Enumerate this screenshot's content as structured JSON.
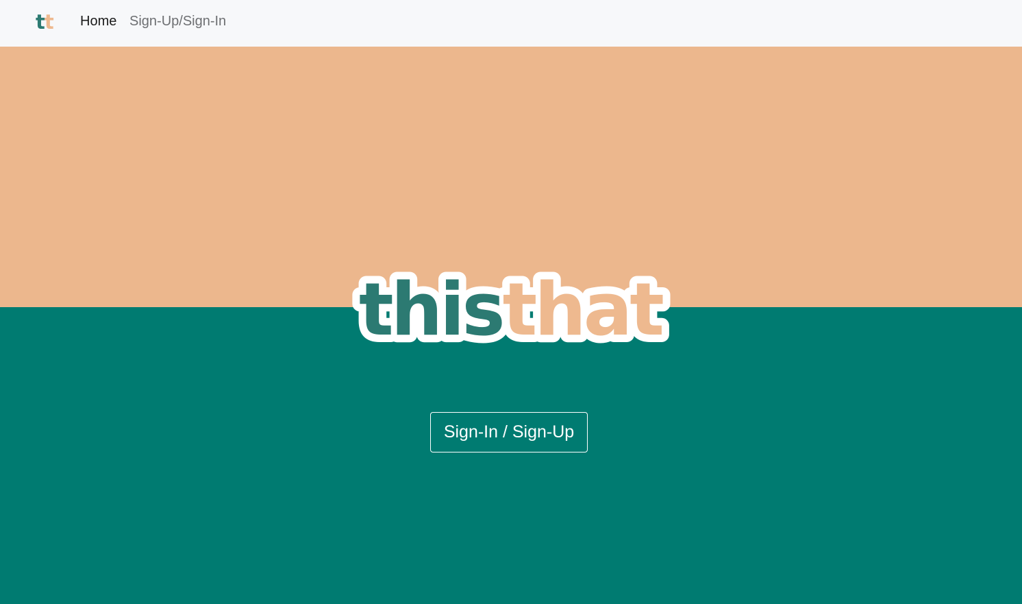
{
  "navbar": {
    "brand": {
      "part1": "t",
      "part2": "t"
    },
    "links": [
      {
        "label": "Home",
        "active": true
      },
      {
        "label": "Sign-Up/Sign-In",
        "active": false
      }
    ]
  },
  "hero": {
    "logo": {
      "part1": "this",
      "part2": "that"
    },
    "cta_label": "Sign-In / Sign-Up"
  },
  "colors": {
    "navbar_bg": "#f7f8fa",
    "top_band": "#ecb78d",
    "bottom_band": "#007b71",
    "logo_this": "#2c7a72",
    "logo_that": "#eeb98f",
    "logo_outline": "#ffffff",
    "nav_active": "#1b1b1b",
    "nav_muted": "#6d6f72"
  }
}
